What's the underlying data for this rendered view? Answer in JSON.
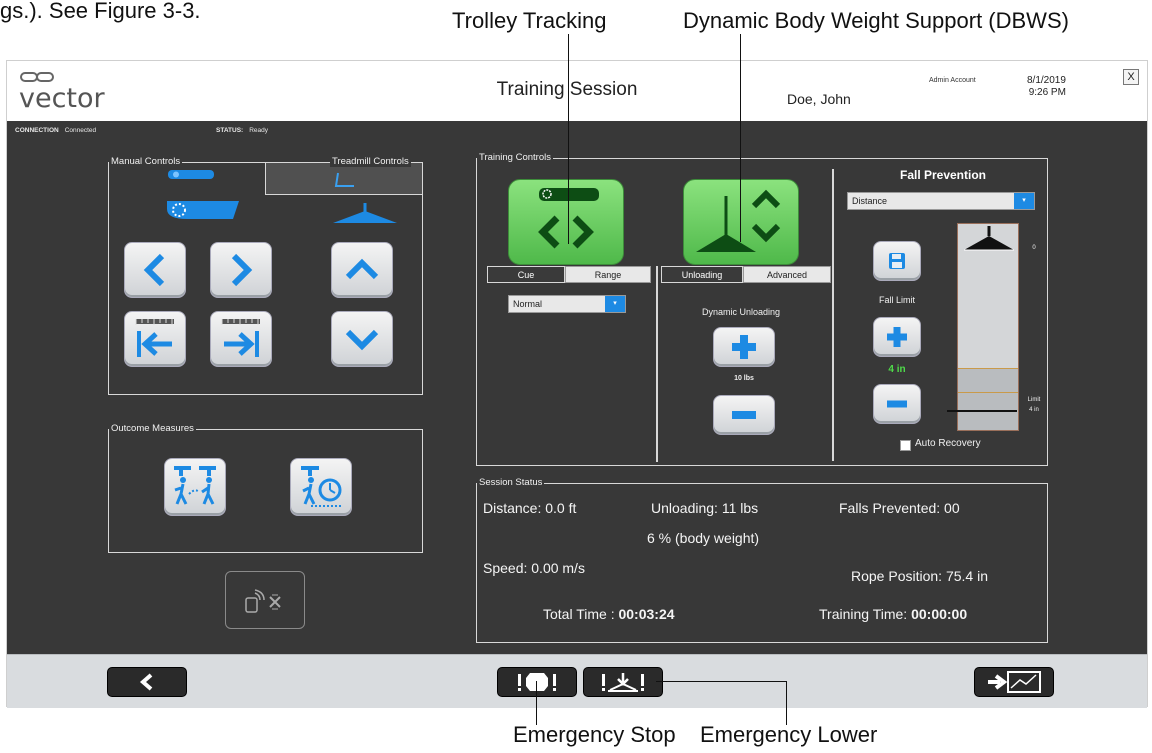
{
  "document": {
    "caption_fragment": "gs.). See Figure 3-3.",
    "callouts": {
      "trolley_tracking": "Trolley Tracking",
      "dbws": "Dynamic Body Weight Support (DBWS)",
      "emergency_stop": "Emergency Stop",
      "emergency_lower": "Emergency Lower"
    }
  },
  "header": {
    "title": "Training Session",
    "user": "Doe, John",
    "account": "Admin Account",
    "date": "8/1/2019",
    "time": "9:26 PM",
    "close_label": "X"
  },
  "status_bar": {
    "connection_label": "CONNECTION",
    "connection_value": "Connected",
    "status_label": "STATUS:",
    "status_value": "Ready"
  },
  "manual_controls": {
    "label": "Manual Controls",
    "treadmill_tab": "Treadmill Controls"
  },
  "outcome_measures": {
    "label": "Outcome Measures"
  },
  "training_controls": {
    "label": "Training Controls",
    "trolley_tabs": [
      "Cue",
      "Range"
    ],
    "trolley_select": "Normal",
    "dbws_tabs": [
      "Unloading",
      "Advanced"
    ],
    "dynamic_unloading_label": "Dynamic Unloading",
    "unloading_value": "10 lbs"
  },
  "fall_prevention": {
    "title": "Fall Prevention",
    "mode": "Distance",
    "fall_limit_label": "Fall Limit",
    "fall_limit_value": "4 in",
    "scale_zero": "0",
    "limit_label": "Limit",
    "limit_value": "4 in",
    "auto_recovery_label": "Auto Recovery",
    "auto_recovery_checked": false
  },
  "session_status": {
    "label": "Session Status",
    "distance": "Distance: 0.0 ft",
    "unloading": "Unloading: 11  lbs",
    "body_weight": "6 % (body weight)",
    "falls_prevented": "Falls Prevented: 00",
    "speed": "Speed: 0.00 m/s",
    "rope_position": "Rope Position: 75.4 in",
    "total_time_label": "Total Time : ",
    "total_time_value": "00:03:24",
    "training_time_label": "Training Time: ",
    "training_time_value": "00:00:00"
  },
  "colors": {
    "accent_blue": "#1d8ae3",
    "green_button": "#5cc653",
    "fall_limit_green": "#4fdc4a",
    "workarea_bg": "#383838"
  }
}
